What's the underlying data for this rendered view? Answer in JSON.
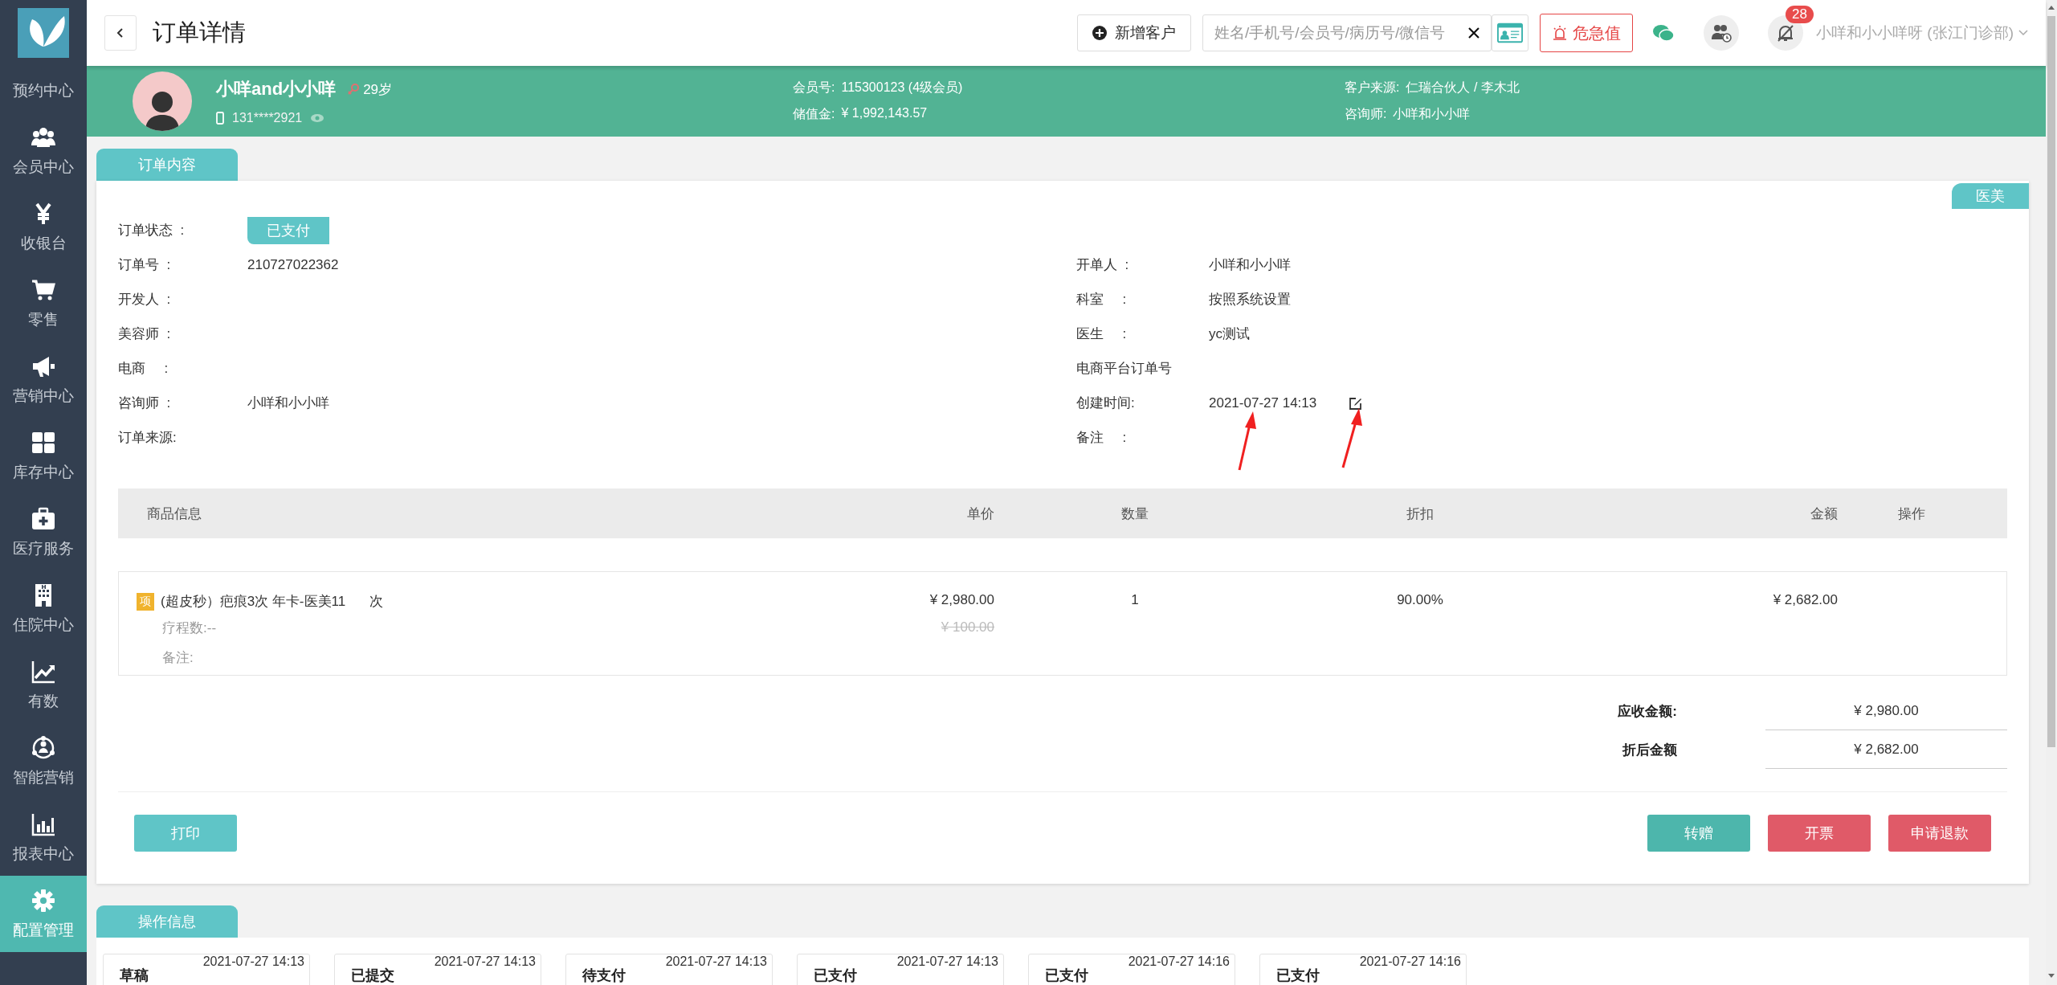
{
  "sidebar": {
    "items": [
      {
        "label": "预约中心",
        "selected": false
      },
      {
        "label": "会员中心",
        "selected": false
      },
      {
        "label": "收银台",
        "selected": false
      },
      {
        "label": "零售",
        "selected": false
      },
      {
        "label": "营销中心",
        "selected": false
      },
      {
        "label": "库存中心",
        "selected": false
      },
      {
        "label": "医疗服务",
        "selected": false
      },
      {
        "label": "住院中心",
        "selected": false
      },
      {
        "label": "有数",
        "selected": false
      },
      {
        "label": "智能营销",
        "selected": false
      },
      {
        "label": "报表中心",
        "selected": false
      },
      {
        "label": "配置管理",
        "selected": true
      }
    ]
  },
  "topbar": {
    "title": "订单详情",
    "new_customer": "新增客户",
    "search": {
      "placeholder": "姓名/手机号/会员号/病历号/微信号"
    },
    "alert": "危急值",
    "notification_count": "28",
    "user": "小咩和小小咩呀 (张江门诊部)"
  },
  "customer": {
    "name": "小咩and小小咩",
    "age": "29岁",
    "phone": "131****2921",
    "fields": [
      {
        "label": "会员号:",
        "value": "115300123 (4级会员)"
      },
      {
        "label": "储值金:",
        "value": "¥ 1,992,143.57"
      },
      {
        "label": "客户来源:",
        "value": "仁瑞合伙人 / 李木北"
      },
      {
        "label": "咨询师:",
        "value": "小咩和小小咩"
      }
    ]
  },
  "order": {
    "tab": "订单内容",
    "category_tag": "医美",
    "status_label": "订单状态  :",
    "status": "已支付",
    "left_fields": [
      {
        "label": "订单号  :",
        "value": "210727022362"
      },
      {
        "label": "开发人  :"
      },
      {
        "label": "美容师  :"
      },
      {
        "label": "电商     :"
      },
      {
        "label": "咨询师  :",
        "value": "小咩和小小咩"
      },
      {
        "label": "订单来源:"
      }
    ],
    "right_fields": [
      {
        "label": "开单人  :",
        "value": "小咩和小小咩",
        "kind": "plain"
      },
      {
        "label": "科室     :",
        "value": "按照系统设置",
        "kind": "plain"
      },
      {
        "label": "医生     :",
        "value": "yc测试",
        "kind": "plain"
      },
      {
        "label": "电商平台订单号",
        "kind": "plain"
      },
      {
        "label": "创建时间:",
        "value": "2021-07-27 14:13",
        "kind": "editable"
      },
      {
        "label": "备注     :",
        "kind": "plain"
      }
    ]
  },
  "table": {
    "columns": [
      "商品信息",
      "单价",
      "数量",
      "折扣",
      "金额",
      "操作"
    ],
    "rows": [
      {
        "badge": "项",
        "name": "(超皮秒）疤痕3次 年卡-医美11",
        "unit": "次",
        "course": "疗程数:--",
        "note": "备注:",
        "price": "¥ 2,980.00",
        "original_price": "¥ 100.00",
        "quantity": "1",
        "discount": "90.00%",
        "amount": "¥ 2,682.00"
      }
    ]
  },
  "totals": [
    {
      "label": "应收金额:",
      "value": "¥ 2,980.00"
    },
    {
      "label": "折后金额",
      "value": "¥ 2,682.00"
    }
  ],
  "actions": {
    "left": [
      {
        "label": "打印",
        "kind": "info"
      }
    ],
    "right": [
      {
        "label": "转赠",
        "kind": "success"
      },
      {
        "label": "开票",
        "kind": "danger"
      },
      {
        "label": "申请退款",
        "kind": "danger"
      }
    ]
  },
  "operations": {
    "tab": "操作信息",
    "steps": [
      {
        "status": "草稿",
        "time": "2021-07-27 14:13"
      },
      {
        "status": "已提交",
        "time": "2021-07-27 14:13"
      },
      {
        "status": "待支付",
        "time": "2021-07-27 14:13"
      },
      {
        "status": "已支付",
        "time": "2021-07-27 14:13"
      },
      {
        "status": "已支付",
        "time": "2021-07-27 14:16"
      },
      {
        "status": "已支付",
        "time": "2021-07-27 14:16"
      }
    ]
  }
}
